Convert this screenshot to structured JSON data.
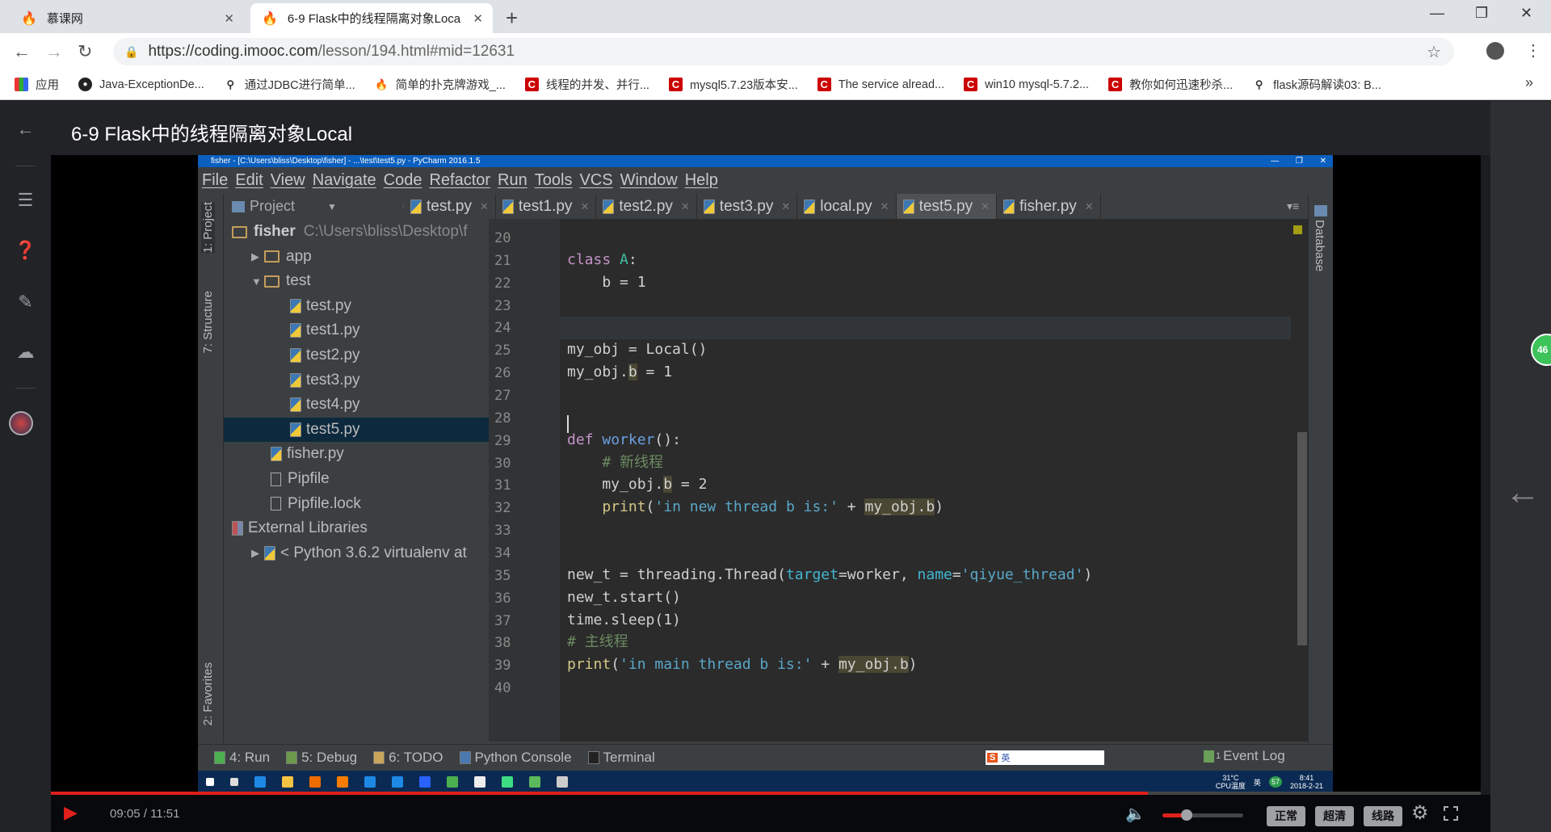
{
  "browser": {
    "tabs": [
      {
        "title": "慕课网",
        "icon": "flame-icon"
      },
      {
        "title": "6-9 Flask中的线程隔离对象Loca",
        "icon": "flame-icon",
        "active": true
      }
    ],
    "url_host": "https://coding.imooc.com",
    "url_path": "/lesson/194.html#mid=12631",
    "bookmarks": [
      {
        "label": "应用",
        "icon": "apps-icon"
      },
      {
        "label": "Java-ExceptionDe...",
        "icon": "github-icon"
      },
      {
        "label": "通过JDBC进行简单...",
        "icon": "bookmark-icon"
      },
      {
        "label": "简单的扑克牌游戏_...",
        "icon": "flame-icon"
      },
      {
        "label": "线程的并发、并行...",
        "icon": "csdn-icon"
      },
      {
        "label": "mysql5.7.23版本安...",
        "icon": "csdn-icon"
      },
      {
        "label": "The service alread...",
        "icon": "csdn-icon"
      },
      {
        "label": "win10 mysql-5.7.2...",
        "icon": "csdn-icon"
      },
      {
        "label": "教你如何迅速秒杀...",
        "icon": "csdn-icon"
      },
      {
        "label": "flask源码解读03: B...",
        "icon": "bookmark-icon"
      }
    ]
  },
  "lesson": {
    "title": "6-9 Flask中的线程隔离对象Local"
  },
  "pycharm": {
    "title": "fisher - [C:\\Users\\bliss\\Desktop\\fisher] - ...\\test\\test5.py - PyCharm 2016.1.5",
    "menu": [
      "File",
      "Edit",
      "View",
      "Navigate",
      "Code",
      "Refactor",
      "Run",
      "Tools",
      "VCS",
      "Window",
      "Help"
    ],
    "side_tabs": [
      "1: Project",
      "7: Structure",
      "2: Favorites"
    ],
    "right_tab": "Database",
    "project_label": "Project",
    "tabs": [
      "test.py",
      "test1.py",
      "test2.py",
      "test3.py",
      "local.py",
      "test5.py",
      "fisher.py"
    ],
    "active_tab": "test5.py",
    "tree": [
      {
        "label": "fisher",
        "detail": "C:\\Users\\bliss\\Desktop\\f",
        "type": "root",
        "depth": 0
      },
      {
        "label": "app",
        "type": "folder",
        "depth": 1,
        "expanded": false
      },
      {
        "label": "test",
        "type": "folder",
        "depth": 1,
        "expanded": true
      },
      {
        "label": "test.py",
        "type": "py",
        "depth": 2
      },
      {
        "label": "test1.py",
        "type": "py",
        "depth": 2
      },
      {
        "label": "test2.py",
        "type": "py",
        "depth": 2
      },
      {
        "label": "test3.py",
        "type": "py",
        "depth": 2
      },
      {
        "label": "test4.py",
        "type": "py",
        "depth": 2
      },
      {
        "label": "test5.py",
        "type": "py",
        "depth": 2,
        "selected": true
      },
      {
        "label": "fisher.py",
        "type": "py",
        "depth": 1
      },
      {
        "label": "Pipfile",
        "type": "file",
        "depth": 1
      },
      {
        "label": "Pipfile.lock",
        "type": "file",
        "depth": 1
      },
      {
        "label": "External Libraries",
        "type": "lib",
        "depth": 0
      },
      {
        "label": "< Python 3.6.2 virtualenv at",
        "type": "python",
        "depth": 1,
        "expanded": false
      }
    ],
    "code": [
      {
        "n": "20",
        "t": []
      },
      {
        "n": "21",
        "t": [
          [
            "kw",
            "class"
          ],
          [
            "",
            ""
          ],
          [
            "cls",
            " A"
          ],
          [
            "",
            ":"
          ]
        ]
      },
      {
        "n": "22",
        "t": [
          [
            "",
            "    b = 1"
          ]
        ]
      },
      {
        "n": "23",
        "t": []
      },
      {
        "n": "24",
        "t": []
      },
      {
        "n": "25",
        "t": [
          [
            "",
            "my_obj = Local()"
          ]
        ]
      },
      {
        "n": "26",
        "t": [
          [
            "",
            "my_obj."
          ],
          [
            "hl",
            "b"
          ],
          [
            "",
            " = 1"
          ]
        ]
      },
      {
        "n": "27",
        "t": []
      },
      {
        "n": "28",
        "t": []
      },
      {
        "n": "29",
        "t": [
          [
            "kw",
            "def "
          ],
          [
            "fn",
            "worker"
          ],
          [
            "",
            "():"
          ]
        ]
      },
      {
        "n": "30",
        "t": [
          [
            "cm",
            "    # 新线程"
          ]
        ]
      },
      {
        "n": "31",
        "t": [
          [
            "",
            "    my_obj."
          ],
          [
            "hl",
            "b"
          ],
          [
            "",
            " = 2"
          ]
        ]
      },
      {
        "n": "32",
        "t": [
          [
            "bi",
            "    print"
          ],
          [
            "",
            "("
          ],
          [
            "str",
            "'in new thread b is:'"
          ],
          [
            "",
            " + "
          ],
          [
            "hl",
            "my_obj.b"
          ],
          [
            "",
            ")"
          ]
        ]
      },
      {
        "n": "33",
        "t": []
      },
      {
        "n": "34",
        "t": []
      },
      {
        "n": "35",
        "t": [
          [
            "",
            "new_t = threading.Thread("
          ],
          [
            "par",
            "target"
          ],
          [
            "",
            "=worker, "
          ],
          [
            "par",
            "name"
          ],
          [
            "",
            "="
          ],
          [
            "str",
            "'qiyue_thread'"
          ],
          [
            "",
            ")"
          ]
        ]
      },
      {
        "n": "36",
        "t": [
          [
            "",
            "new_t.start()"
          ]
        ]
      },
      {
        "n": "37",
        "t": [
          [
            "",
            "time.sleep(1)"
          ]
        ]
      },
      {
        "n": "38",
        "t": [
          [
            "cm",
            "# 主线程"
          ]
        ]
      },
      {
        "n": "39",
        "t": [
          [
            "bi",
            "print"
          ],
          [
            "",
            "("
          ],
          [
            "str",
            "'in main thread b is:'"
          ],
          [
            "",
            " + "
          ],
          [
            "hl",
            "my_obj.b"
          ],
          [
            "",
            ")"
          ]
        ]
      },
      {
        "n": "40",
        "t": []
      }
    ],
    "bottom_tools": [
      {
        "label": "4: Run",
        "icon": "run-icon"
      },
      {
        "label": "5: Debug",
        "icon": "debug-icon"
      },
      {
        "label": "6: TODO",
        "icon": "todo-icon"
      },
      {
        "label": "Python Console",
        "icon": "python-console-icon"
      },
      {
        "label": "Terminal",
        "icon": "terminal-icon"
      }
    ],
    "event_log": "Event Log",
    "event_count": "1",
    "ime_label": "英",
    "tray": {
      "temp": "31°C",
      "temp_label": "CPU温度",
      "ime": "英",
      "time": "8:41",
      "date": "2018-2-21",
      "badge": "57"
    }
  },
  "player": {
    "current": "09:05",
    "duration": "11:51",
    "time_text": "09:05 / 11:51",
    "progress_fraction": 0.767,
    "volume_fraction": 0.3,
    "buttons": [
      "正常",
      "超清",
      "线路"
    ]
  },
  "badge": {
    "count": "46"
  },
  "colors": {
    "accent": "#e0201a",
    "title_bar": "#0a5fbf",
    "editor_bg": "#2b2b2b"
  }
}
